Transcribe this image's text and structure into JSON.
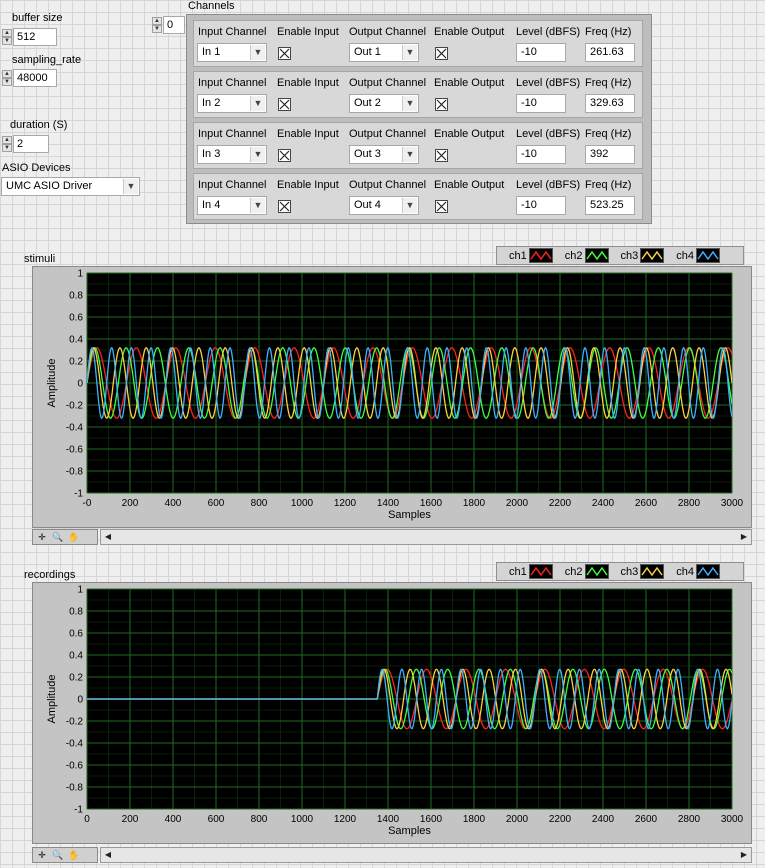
{
  "controls": {
    "buffer_size": {
      "label": "buffer size",
      "value": "512"
    },
    "sampling_rate": {
      "label": "sampling_rate",
      "value": "48000"
    },
    "duration": {
      "label": "duration (S)",
      "value": "2"
    },
    "asio": {
      "label": "ASIO Devices",
      "value": "UMC ASIO Driver"
    },
    "channels_index": "0"
  },
  "channels": {
    "title": "Channels",
    "headers": {
      "input_channel": "Input Channel",
      "enable_input": "Enable Input",
      "output_channel": "Output Channel",
      "enable_output": "Enable Output",
      "level": "Level (dBFS)",
      "freq": "Freq (Hz)"
    },
    "rows": [
      {
        "input": "In 1",
        "output": "Out 1",
        "level": "-10",
        "freq": "261.63"
      },
      {
        "input": "In 2",
        "output": "Out 2",
        "level": "-10",
        "freq": "329.63"
      },
      {
        "input": "In 3",
        "output": "Out 3",
        "level": "-10",
        "freq": "392"
      },
      {
        "input": "In 4",
        "output": "Out 4",
        "level": "-10",
        "freq": "523.25"
      }
    ]
  },
  "legend": [
    "ch1",
    "ch2",
    "ch3",
    "ch4"
  ],
  "colors": {
    "ch1": "#ff2020",
    "ch2": "#40ff40",
    "ch3": "#ffd040",
    "ch4": "#3fb0ff",
    "plot_bg": "#000000",
    "grid": "#1f6b1f"
  },
  "chart_data": [
    {
      "type": "line",
      "title": "stimuli",
      "xlabel": "Samples",
      "ylabel": "Amplitude",
      "xlim": [
        0,
        3000
      ],
      "ylim": [
        -1,
        1
      ],
      "x_ticks": [
        "-0",
        "200",
        "400",
        "600",
        "800",
        "1000",
        "1200",
        "1400",
        "1600",
        "1800",
        "2000",
        "2200",
        "2400",
        "2600",
        "2800",
        "3000"
      ],
      "y_ticks": [
        "1",
        "0.8",
        "0.6",
        "0.4",
        "0.2",
        "0",
        "-0.2",
        "-0.4",
        "-0.6",
        "-0.8",
        "-1"
      ],
      "series": [
        {
          "name": "ch1",
          "amplitude": 0.32,
          "freq_hz": 261.63,
          "start_sample": 0
        },
        {
          "name": "ch2",
          "amplitude": 0.32,
          "freq_hz": 329.63,
          "start_sample": 0
        },
        {
          "name": "ch3",
          "amplitude": 0.32,
          "freq_hz": 392,
          "start_sample": 0
        },
        {
          "name": "ch4",
          "amplitude": 0.32,
          "freq_hz": 523.25,
          "start_sample": 0
        }
      ],
      "sample_rate": 48000
    },
    {
      "type": "line",
      "title": "recordings",
      "xlabel": "Samples",
      "ylabel": "Amplitude",
      "xlim": [
        0,
        3000
      ],
      "ylim": [
        -1,
        1
      ],
      "x_ticks": [
        "0",
        "200",
        "400",
        "600",
        "800",
        "1000",
        "1200",
        "1400",
        "1600",
        "1800",
        "2000",
        "2200",
        "2400",
        "2600",
        "2800",
        "3000"
      ],
      "y_ticks": [
        "1",
        "0.8",
        "0.6",
        "0.4",
        "0.2",
        "0",
        "-0.2",
        "-0.4",
        "-0.6",
        "-0.8",
        "-1"
      ],
      "series": [
        {
          "name": "ch1",
          "amplitude": 0.27,
          "freq_hz": 261.63,
          "start_sample": 1350
        },
        {
          "name": "ch2",
          "amplitude": 0.27,
          "freq_hz": 329.63,
          "start_sample": 1350
        },
        {
          "name": "ch3",
          "amplitude": 0.27,
          "freq_hz": 392,
          "start_sample": 1350
        },
        {
          "name": "ch4",
          "amplitude": 0.27,
          "freq_hz": 523.25,
          "start_sample": 1350
        }
      ],
      "sample_rate": 48000
    }
  ],
  "graph_icons": [
    "cursor-icon",
    "zoom-icon",
    "pan-icon"
  ]
}
